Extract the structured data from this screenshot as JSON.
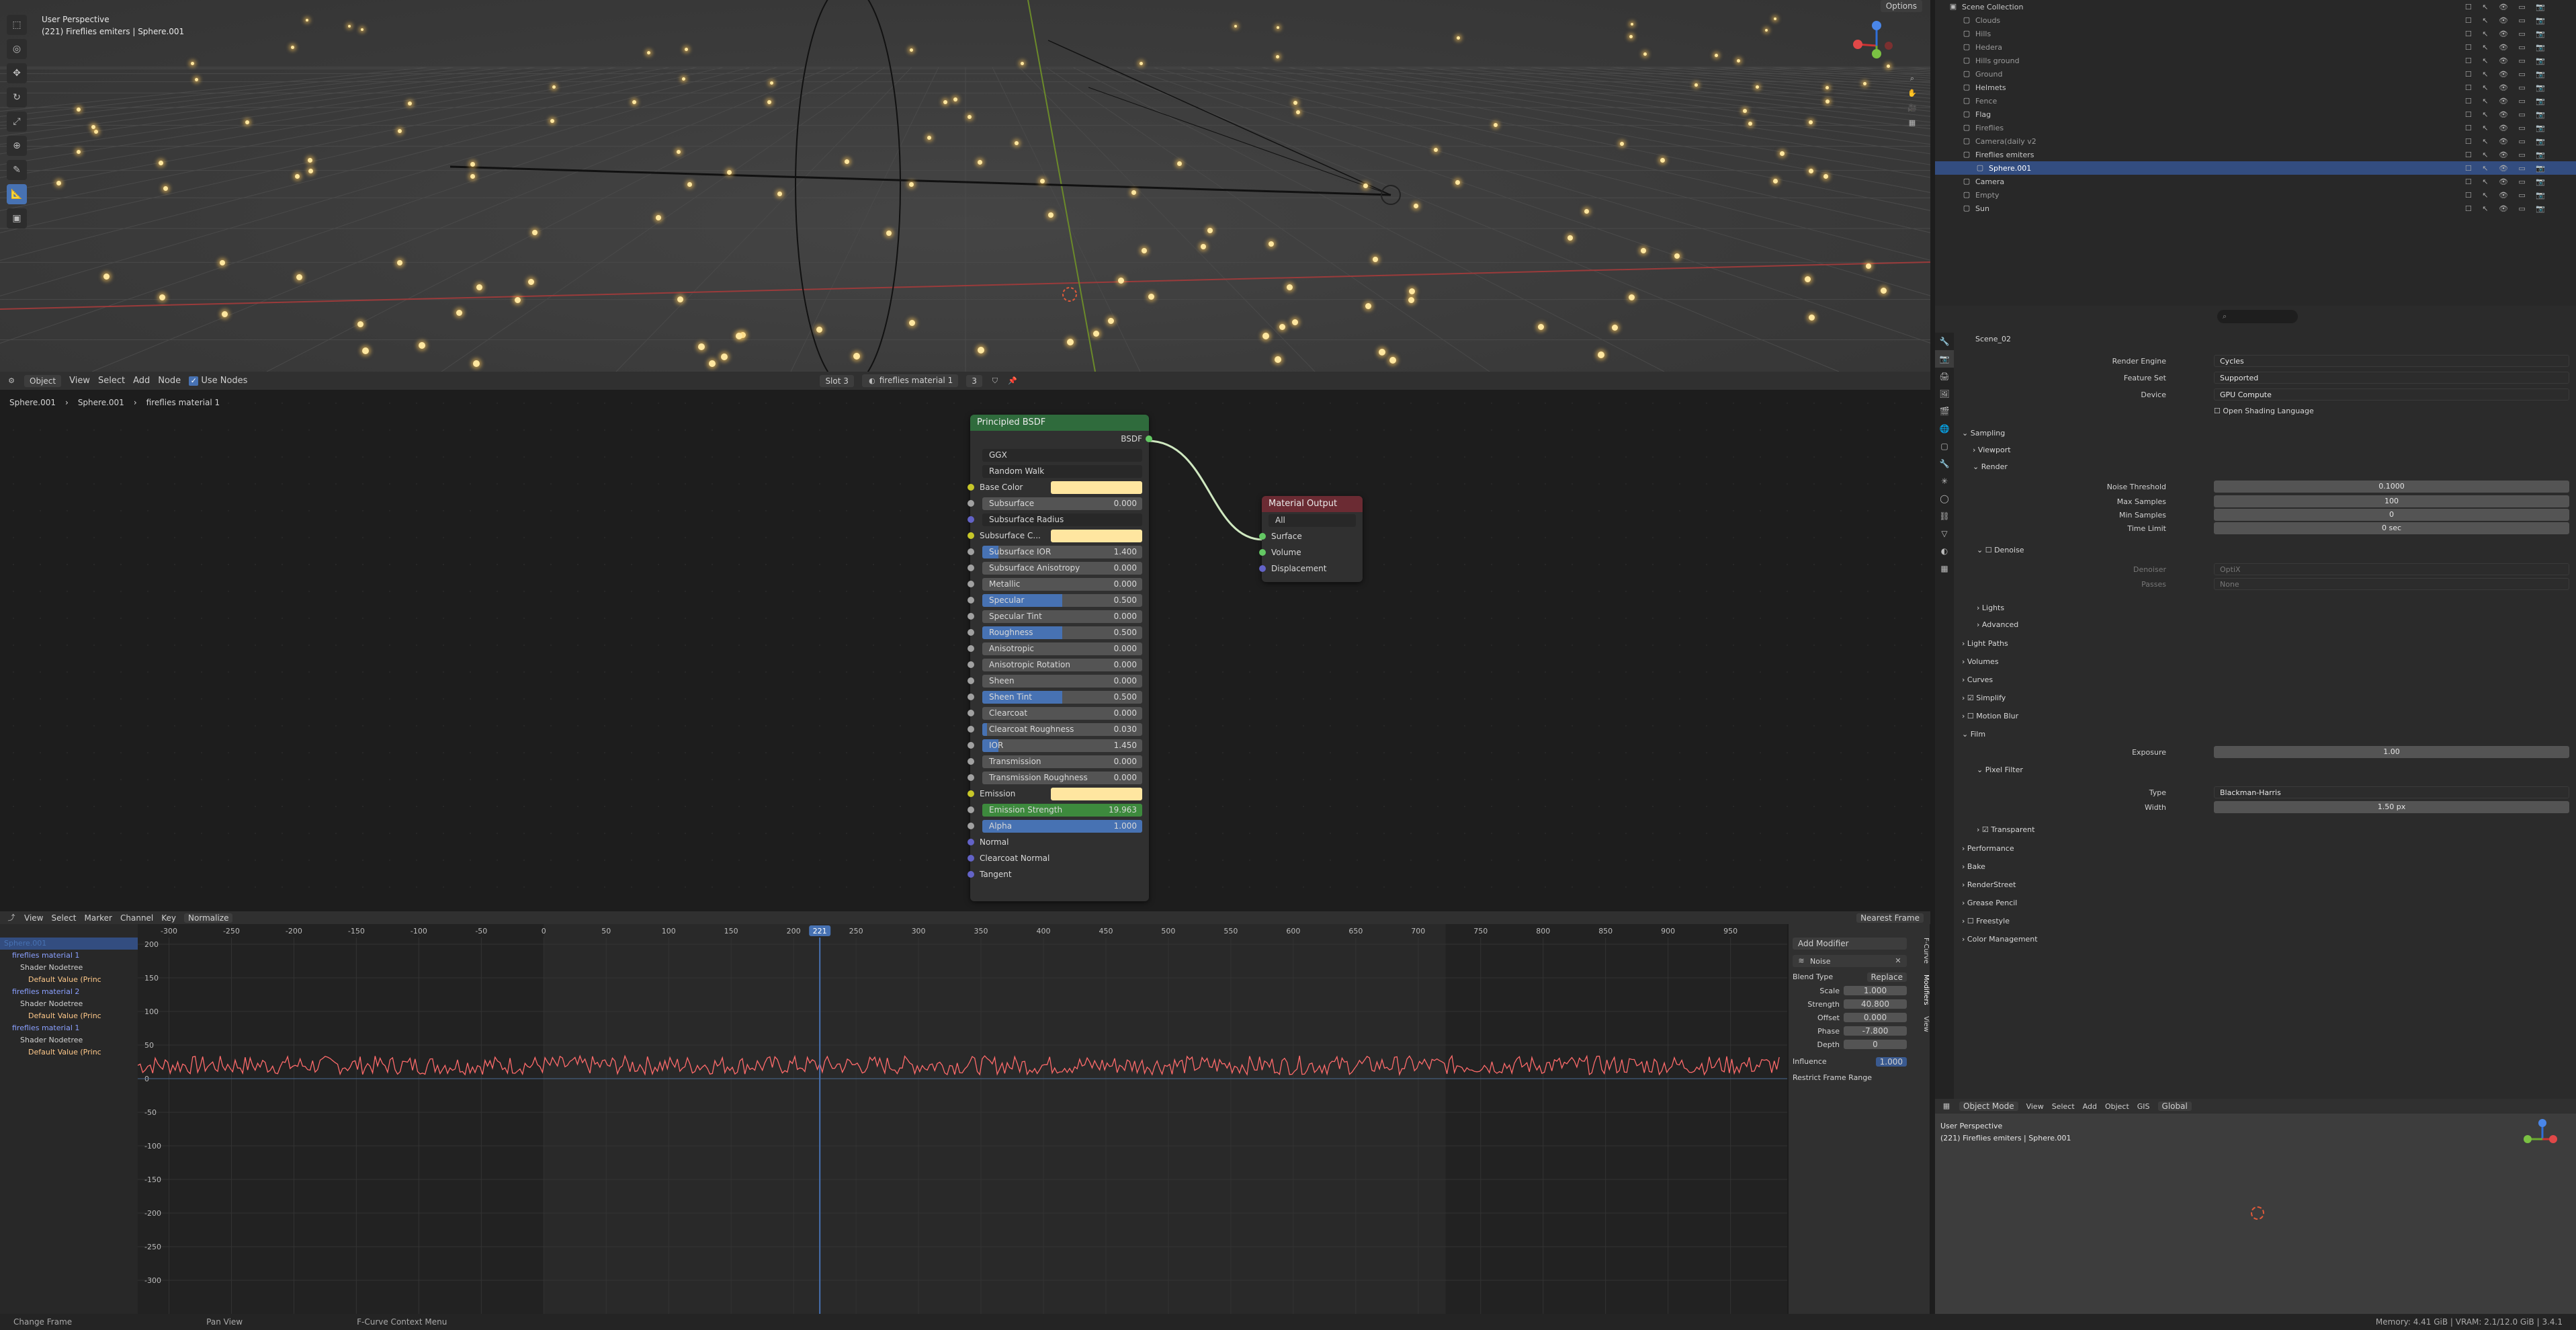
{
  "viewport_top": {
    "title": "User Perspective",
    "subtitle": "(221) Fireflies emiters | Sphere.001",
    "options_label": "Options"
  },
  "node_header": {
    "object_label": "Object",
    "menu": [
      "View",
      "Select",
      "Add",
      "Node"
    ],
    "use_nodes_label": "Use Nodes",
    "slot_label": "Slot 3",
    "material_name": "fireflies material 1",
    "user_count": "3"
  },
  "breadcrumb": {
    "items": [
      "Sphere.001",
      "Sphere.001",
      "fireflies material 1"
    ]
  },
  "principled": {
    "title": "Principled BSDF",
    "output_label": "BSDF",
    "distribution": "GGX",
    "subsurface_method": "Random Walk",
    "inputs": [
      {
        "label": "Base Color",
        "type": "color"
      },
      {
        "label": "Subsurface",
        "value": "0.000",
        "fill": 0
      },
      {
        "label": "Subsurface Radius",
        "type": "dropdown"
      },
      {
        "label": "Subsurface C...",
        "type": "color"
      },
      {
        "label": "Subsurface IOR",
        "value": "1.400",
        "fill": 0.1
      },
      {
        "label": "Subsurface Anisotropy",
        "value": "0.000",
        "fill": 0
      },
      {
        "label": "Metallic",
        "value": "0.000",
        "fill": 0
      },
      {
        "label": "Specular",
        "value": "0.500",
        "fill": 0.5
      },
      {
        "label": "Specular Tint",
        "value": "0.000",
        "fill": 0
      },
      {
        "label": "Roughness",
        "value": "0.500",
        "fill": 0.5
      },
      {
        "label": "Anisotropic",
        "value": "0.000",
        "fill": 0
      },
      {
        "label": "Anisotropic Rotation",
        "value": "0.000",
        "fill": 0
      },
      {
        "label": "Sheen",
        "value": "0.000",
        "fill": 0
      },
      {
        "label": "Sheen Tint",
        "value": "0.500",
        "fill": 0.5
      },
      {
        "label": "Clearcoat",
        "value": "0.000",
        "fill": 0
      },
      {
        "label": "Clearcoat Roughness",
        "value": "0.030",
        "fill": 0.03
      },
      {
        "label": "IOR",
        "value": "1.450",
        "fill": 0.1
      },
      {
        "label": "Transmission",
        "value": "0.000",
        "fill": 0
      },
      {
        "label": "Transmission Roughness",
        "value": "0.000",
        "fill": 0
      },
      {
        "label": "Emission",
        "type": "color"
      },
      {
        "label": "Emission Strength",
        "value": "19.963",
        "fill": 1,
        "green": true
      },
      {
        "label": "Alpha",
        "value": "1.000",
        "fill": 1
      },
      {
        "label": "Normal",
        "type": "plain"
      },
      {
        "label": "Clearcoat Normal",
        "type": "plain"
      },
      {
        "label": "Tangent",
        "type": "plain"
      }
    ]
  },
  "material_output": {
    "title": "Material Output",
    "target": "All",
    "inputs": [
      "Surface",
      "Volume",
      "Displacement"
    ]
  },
  "graph_header": {
    "menu": [
      "View",
      "Select",
      "Marker",
      "Channel",
      "Key"
    ],
    "normalize_label": "Normalize",
    "snap_label": "Nearest Frame"
  },
  "graph": {
    "current_frame": "221",
    "frame_ticks": [
      "-300",
      "-250",
      "-200",
      "-150",
      "-100",
      "-50",
      "0",
      "50",
      "100",
      "150",
      "200",
      "250",
      "300",
      "350",
      "400",
      "450",
      "500",
      "550",
      "600",
      "650",
      "700",
      "750",
      "800",
      "850",
      "900",
      "950"
    ],
    "value_ticks": [
      "200",
      "150",
      "100",
      "50",
      "0",
      "-50",
      "-100",
      "-150",
      "-200",
      "-250",
      "-300"
    ]
  },
  "channels": [
    {
      "label": "Sphere.001",
      "level": 0,
      "color": "#4772b3"
    },
    {
      "label": "fireflies material 1",
      "level": 1,
      "color": "#8aa0ff"
    },
    {
      "label": "Shader Nodetree",
      "level": 2,
      "color": "#cfcfcf"
    },
    {
      "label": "Default Value (Princ",
      "level": 3,
      "color": "#ffc98a"
    },
    {
      "label": "fireflies material 2",
      "level": 1,
      "color": "#8aa0ff"
    },
    {
      "label": "Shader Nodetree",
      "level": 2,
      "color": "#cfcfcf"
    },
    {
      "label": "Default Value (Princ",
      "level": 3,
      "color": "#ffc98a"
    },
    {
      "label": "fireflies material 1",
      "level": 1,
      "color": "#8aa0ff"
    },
    {
      "label": "Shader Nodetree",
      "level": 2,
      "color": "#cfcfcf"
    },
    {
      "label": "Default Value (Princ",
      "level": 3,
      "color": "#ffc98a"
    }
  ],
  "modifier_panel": {
    "add_modifier": "Add Modifier",
    "modifier_name": "Noise",
    "blend_label": "Blend Type",
    "blend_value": "Replace",
    "fields": [
      {
        "label": "Scale",
        "value": "1.000"
      },
      {
        "label": "Strength",
        "value": "40.800"
      },
      {
        "label": "Offset",
        "value": "0.000"
      },
      {
        "label": "Phase",
        "value": "-7.800"
      },
      {
        "label": "Depth",
        "value": "0"
      }
    ],
    "influence_label": "Influence",
    "influence_value": "1.000",
    "restrict_label": "Restrict Frame Range",
    "tabs": [
      "F-Curve",
      "Modifiers",
      "View"
    ]
  },
  "outliner": {
    "rows": [
      {
        "label": "Scene Collection",
        "indent": 0
      },
      {
        "label": "Clouds",
        "indent": 1,
        "dim": true
      },
      {
        "label": "Hills",
        "indent": 1,
        "dim": true
      },
      {
        "label": "Hedera",
        "indent": 1,
        "dim": true
      },
      {
        "label": "Hills ground",
        "indent": 1,
        "dim": true
      },
      {
        "label": "Ground",
        "indent": 1,
        "dim": true
      },
      {
        "label": "Helmets",
        "indent": 1
      },
      {
        "label": "Fence",
        "indent": 1,
        "dim": true
      },
      {
        "label": "Flag",
        "indent": 1
      },
      {
        "label": "Fireflies",
        "indent": 1,
        "dim": true
      },
      {
        "label": "Camera(daily v2",
        "indent": 1,
        "dim": true
      },
      {
        "label": "Fireflies emiters",
        "indent": 1
      },
      {
        "label": "Sphere.001",
        "indent": 2,
        "selected": true
      },
      {
        "label": "Camera",
        "indent": 1
      },
      {
        "label": "Empty",
        "indent": 1,
        "dim": true
      },
      {
        "label": "Sun",
        "indent": 1
      }
    ]
  },
  "properties": {
    "scene_name": "Scene_02",
    "render_engine_label": "Render Engine",
    "render_engine": "Cycles",
    "feature_set_label": "Feature Set",
    "feature_set": "Supported",
    "device_label": "Device",
    "device": "GPU Compute",
    "osl_label": "Open Shading Language",
    "sampling": "Sampling",
    "viewport": "Viewport",
    "render": "Render",
    "noise_threshold_label": "Noise Threshold",
    "noise_threshold": "0.1000",
    "max_samples_label": "Max Samples",
    "max_samples": "100",
    "min_samples_label": "Min Samples",
    "min_samples": "0",
    "time_limit_label": "Time Limit",
    "time_limit": "0 sec",
    "denoise": "Denoise",
    "denoiser_label": "Denoiser",
    "denoiser": "OptiX",
    "passes_label": "Passes",
    "passes": "None",
    "lights": "Lights",
    "advanced": "Advanced",
    "light_paths": "Light Paths",
    "volumes": "Volumes",
    "curves": "Curves",
    "simplify": "Simplify",
    "motion_blur": "Motion Blur",
    "film": "Film",
    "exposure_label": "Exposure",
    "exposure": "1.00",
    "pixel_filter": "Pixel Filter",
    "type_label": "Type",
    "type": "Blackman-Harris",
    "width_label": "Width",
    "width": "1.50 px",
    "transparent": "Transparent",
    "performance": "Performance",
    "bake": "Bake",
    "renderstreet": "RenderStreet",
    "grease_pencil": "Grease Pencil",
    "freestyle": "Freestyle",
    "color_management": "Color Management"
  },
  "viewport_bottom": {
    "menu": [
      "Object Mode",
      "View",
      "Select",
      "Add",
      "Object",
      "GIS"
    ],
    "orientation": "Global",
    "title": "User Perspective",
    "subtitle": "(221) Fireflies emiters | Sphere.001"
  },
  "status": {
    "left": "Change Frame",
    "mid": "Pan View",
    "right_menu": "F-Curve Context Menu",
    "memory": "Memory: 4.41 GiB | VRAM: 2.1/12.0 GiB | 3.4.1"
  }
}
